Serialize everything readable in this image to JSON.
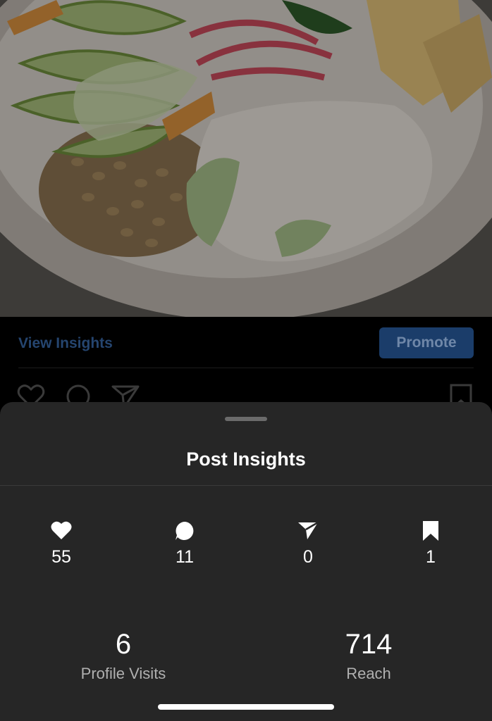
{
  "post": {
    "image_description_icon": "food-bowl-photo",
    "view_insights_label": "View Insights",
    "promote_label": "Promote",
    "action_icons": [
      "heart-outline-icon",
      "comment-outline-icon",
      "send-outline-icon",
      "bookmark-outline-icon"
    ]
  },
  "sheet": {
    "title": "Post Insights",
    "metrics": [
      {
        "icon": "heart-icon",
        "value": "55"
      },
      {
        "icon": "comment-icon",
        "value": "11"
      },
      {
        "icon": "send-icon",
        "value": "0"
      },
      {
        "icon": "bookmark-icon",
        "value": "1"
      }
    ],
    "stats": [
      {
        "value": "6",
        "label": "Profile Visits"
      },
      {
        "value": "714",
        "label": "Reach"
      }
    ]
  },
  "colors": {
    "link_dimmed": "#25456f",
    "button_dimmed": "#1b3d6a",
    "sheet_bg": "#262626"
  }
}
